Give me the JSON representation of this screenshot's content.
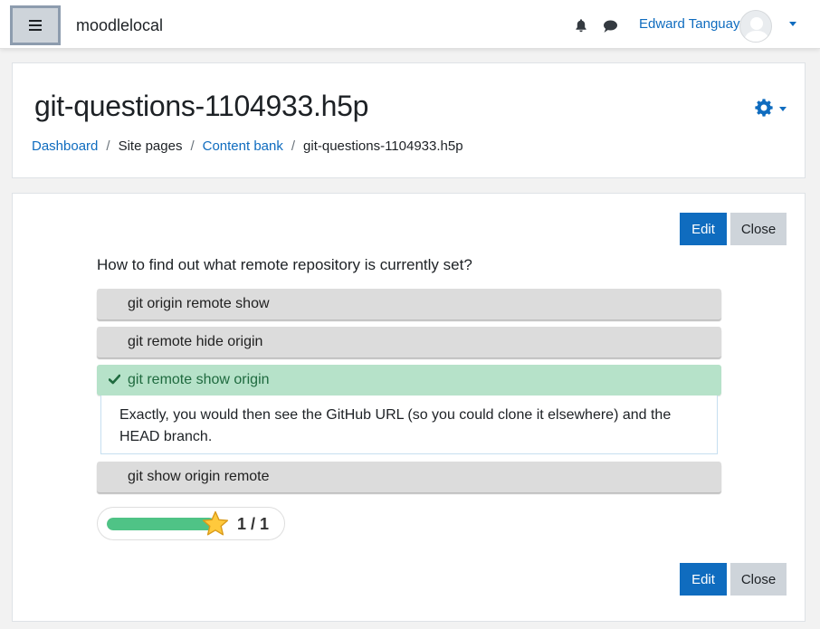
{
  "navbar": {
    "site_name": "moodlelocal",
    "user_name": "Edward Tanguay"
  },
  "header": {
    "title": "git-questions-1104933.h5p",
    "breadcrumb": [
      "Dashboard",
      "Site pages",
      "Content bank",
      "git-questions-1104933.h5p"
    ]
  },
  "actions": {
    "edit_label": "Edit",
    "close_label": "Close"
  },
  "question": {
    "text": "How to find out what remote repository is currently set?",
    "answers": [
      {
        "label": "git origin remote show"
      },
      {
        "label": "git remote hide origin"
      },
      {
        "label": "git remote show origin",
        "selected": true,
        "correct": true
      },
      {
        "label": "git show origin remote"
      }
    ],
    "feedback": "Exactly, you would then see the GitHub URL (so you could clone it elsewhere) and the HEAD branch."
  },
  "score": {
    "text": "1 / 1",
    "current": 1,
    "max": 1,
    "progress_fraction": 1.0
  },
  "colors": {
    "primary": "#0f6cbf",
    "correct_bg": "#b6e2c9",
    "correct_text": "#1f6a3f",
    "answer_bg": "#dcdcdc",
    "progress": "#4fc386",
    "star": "#ffc93c"
  },
  "icons": {
    "menu": "hamburger-icon",
    "notifications": "bell-icon",
    "messages": "chat-bubble-icon",
    "settings": "gear-icon",
    "correct": "checkmark-icon",
    "score": "star-icon"
  }
}
